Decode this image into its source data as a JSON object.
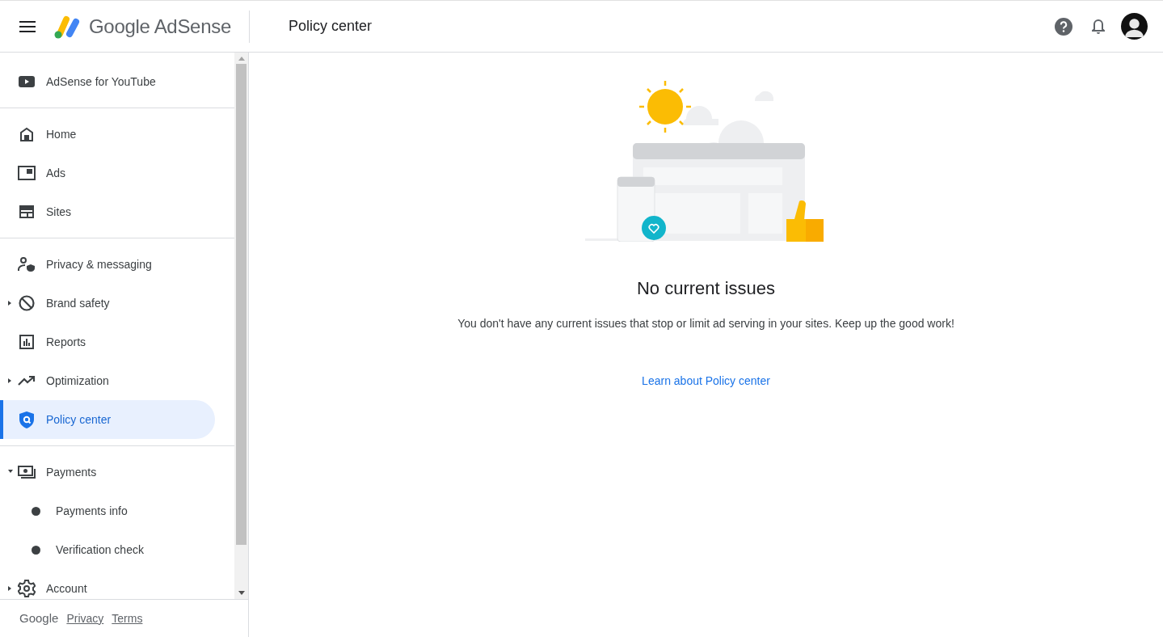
{
  "header": {
    "logo_text": "Google AdSense",
    "page_title": "Policy center"
  },
  "sidebar": {
    "sections": [
      {
        "items": [
          {
            "label": "AdSense for YouTube",
            "selected": false
          }
        ]
      },
      {
        "items": [
          {
            "label": "Home",
            "selected": false
          },
          {
            "label": "Ads",
            "selected": false
          },
          {
            "label": "Sites",
            "selected": false
          }
        ]
      },
      {
        "items": [
          {
            "label": "Privacy & messaging",
            "selected": false
          },
          {
            "label": "Brand safety",
            "selected": false,
            "expanded": false
          },
          {
            "label": "Reports",
            "selected": false
          },
          {
            "label": "Optimization",
            "selected": false,
            "expanded": false
          },
          {
            "label": "Policy center",
            "selected": true
          }
        ]
      },
      {
        "items": [
          {
            "label": "Payments",
            "selected": false,
            "expanded": true,
            "children": [
              {
                "label": "Payments info",
                "selected": false
              },
              {
                "label": "Verification check",
                "selected": false
              }
            ]
          },
          {
            "label": "Account",
            "selected": false,
            "expanded": false
          }
        ]
      }
    ],
    "footer": {
      "brand": "Google",
      "links": [
        "Privacy",
        "Terms"
      ]
    }
  },
  "main": {
    "title": "No current issues",
    "message": "You don't have any current issues that stop or limit ad serving in your sites. Keep up the good work!",
    "link": "Learn about Policy center"
  }
}
